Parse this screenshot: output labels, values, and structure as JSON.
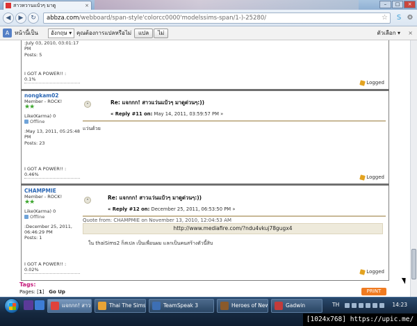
{
  "browser": {
    "tab_title": "สาวหวานแบ้วๆ มาดู",
    "url_host": "abbza.com",
    "url_rest": "/webboard/span-style'colorcc0000'modelssims-span/1-)-25280/"
  },
  "translate_bar": {
    "prefix": "หน้านี้เป็น",
    "language": "อังกฤษ",
    "question": "คุณต้องการแปลหรือไม่",
    "translate_button": "แปล",
    "no_button": "ไม่",
    "options": "ตัวเลือก"
  },
  "post_top": {
    "date_line": ":July 03, 2010, 03:01:17",
    "date_suffix": "PM",
    "posts": "Posts: 5",
    "power": "I GOT A POWER!! :",
    "percent": "0.1%",
    "logged": "Logged"
  },
  "posts": [
    {
      "author": "nongkam02",
      "rank": "Member - ROCK!",
      "stars": "★★",
      "karma": "Like(Karma) 0",
      "status": "Offline",
      "joined_line1": ":May 13, 2011, 05:25:48",
      "joined_line2": "PM",
      "posts": "Posts: 23",
      "power": "I GOT A POWER!! :",
      "percent": "0.46%",
      "subject": "Re: แจกกก! สาวแว่นแบ้วๆ มาดูด่วนๆ:))",
      "reply_label": "« Reply #11 on:",
      "reply_date": "May 14, 2011, 03:59:57 PM »",
      "body": "แว่นด้วย",
      "logged": "Logged"
    },
    {
      "author": "CHAMPMIE",
      "rank": "Member - ROCK!",
      "stars": "★★",
      "karma": "Like(Karma) 0",
      "status": "Offline",
      "joined_line1": ":December 25, 2011,",
      "joined_line2": "06:46:29 PM",
      "posts": "Posts: 1",
      "power": "I GOT A POWER!! :",
      "percent": "0.02%",
      "subject": "Re: แจกกก! สาวแว่นแบ้วๆ มาดูด่วนๆ:))",
      "reply_label": "« Reply #12 on:",
      "reply_date": "December 25, 2011, 06:53:50 PM »",
      "quote_header": "Quote from: CHAMPMIE on November 13, 2010, 12:04:53 AM",
      "quote_link": "http://www.mediafire.com/?ndu4vkuj78gugx4",
      "body": "ใน thaiSims2 ก็สเปล เป็นเพื่อนผม แลกเป็นคนสร้างตัวนี้สิบ",
      "logged": "Logged"
    }
  ],
  "footer": {
    "tags": "Tags:",
    "pages_label": "Pages: [",
    "pages_current": "1",
    "pages_end": "]",
    "go_up": "Go Up",
    "print": "PRINT"
  },
  "taskbar": {
    "tasks": [
      "แจกกก! สาวแว่น...",
      "Thai The Sims ...",
      "TeamSpeak 3",
      "Heroes of New...",
      "Gadwin"
    ],
    "lang": "TH",
    "clock": "14:23"
  },
  "watermark": "[1024x768] https://upic.me/",
  "colors": {
    "accent": "#2b67b5",
    "tag": "#c4187a",
    "print": "#f07b21"
  }
}
